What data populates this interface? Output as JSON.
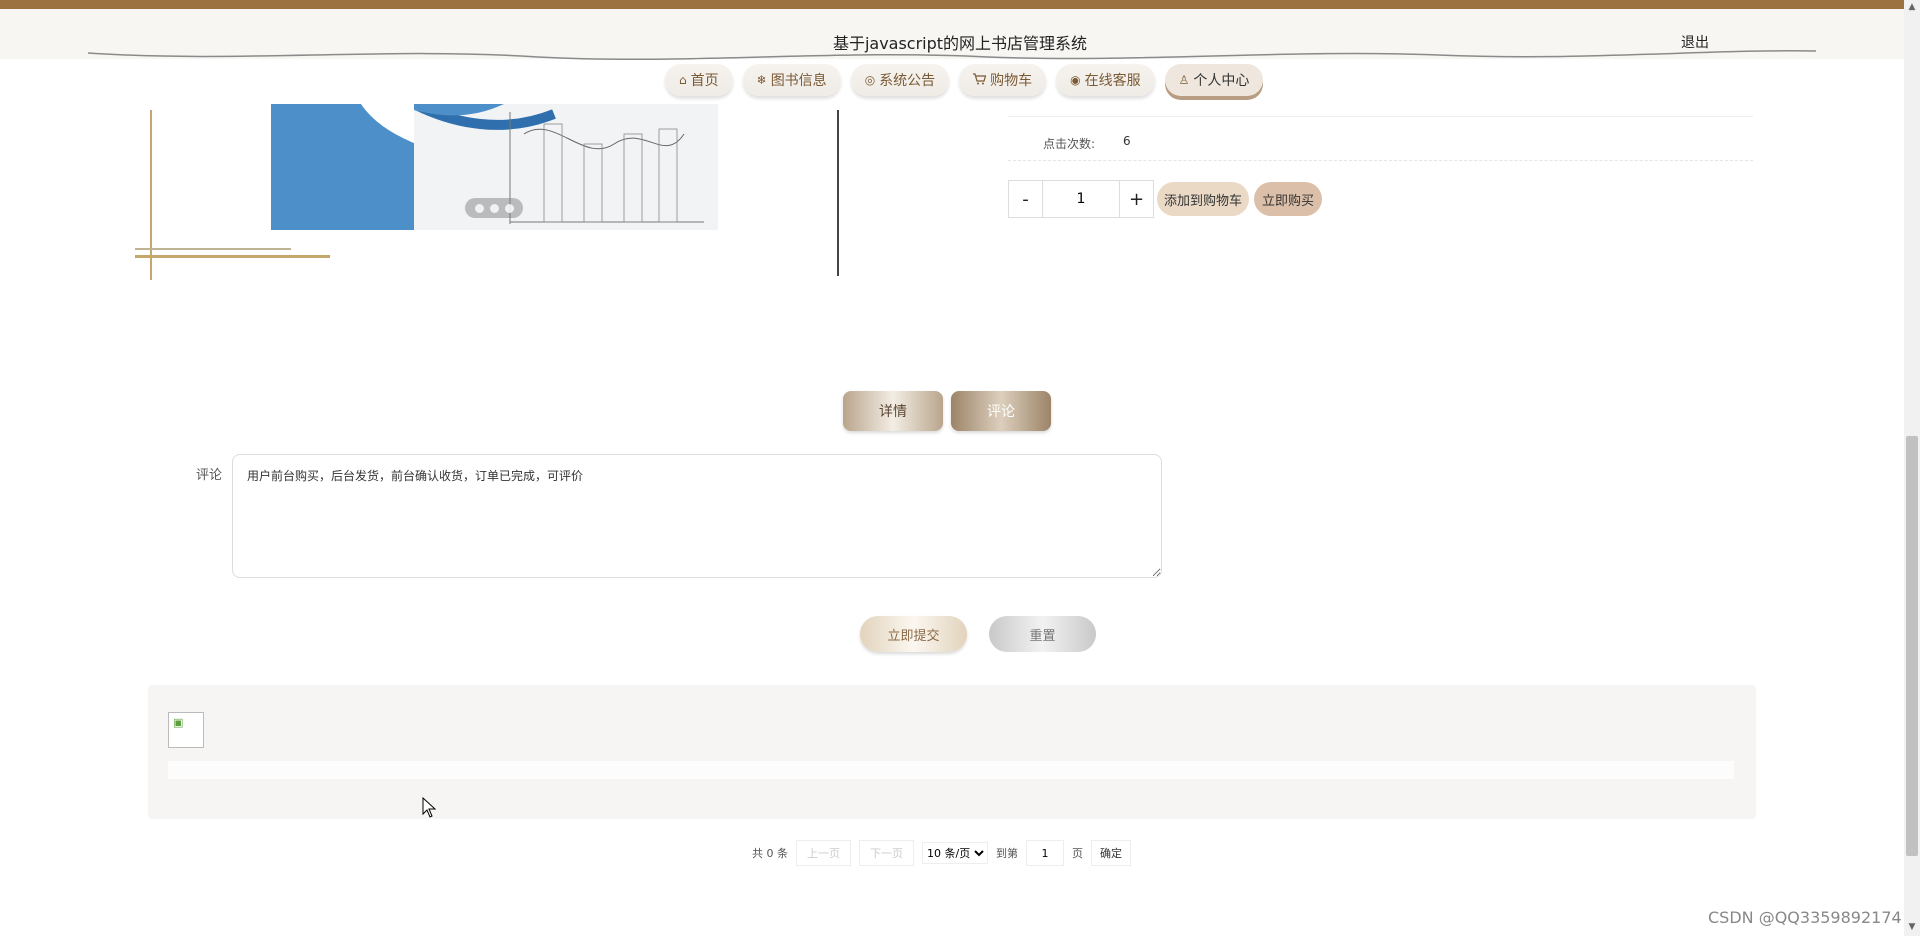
{
  "header": {
    "title": "基于javascript的网上书店管理系统",
    "logout": "退出"
  },
  "nav": [
    {
      "label": "首页",
      "icon": "home-icon",
      "glyph": "⌂"
    },
    {
      "label": "图书信息",
      "icon": "snowflake-icon",
      "glyph": "❄"
    },
    {
      "label": "系统公告",
      "icon": "globe-icon",
      "glyph": "◎"
    },
    {
      "label": "购物车",
      "icon": "cart-icon",
      "glyph": "🛒"
    },
    {
      "label": "在线客服",
      "icon": "chat-icon",
      "glyph": "◉"
    },
    {
      "label": "个人中心",
      "icon": "user-icon",
      "glyph": "♙"
    }
  ],
  "product": {
    "click_label": "点击次数:",
    "click_count": "6",
    "quantity": "1",
    "minus": "-",
    "plus": "+",
    "add_to_cart": "添加到购物车",
    "buy_now": "立即购买"
  },
  "tabs": {
    "detail": "详情",
    "comment": "评论"
  },
  "comment_form": {
    "label": "评论",
    "value": "用户前台购买，后台发货，前台确认收货，订单已完成，可评价",
    "submit": "立即提交",
    "reset": "重置"
  },
  "pagination": {
    "total": "共 0 条",
    "prev": "上一页",
    "next": "下一页",
    "page_size": "10 条/页",
    "goto": "到第",
    "page": "1",
    "page_unit": "页",
    "confirm": "确定"
  },
  "watermark": "CSDN @QQ3359892174",
  "colors": {
    "topbar": "#9b7240",
    "accent": "#7a5a35",
    "slide_blue": "#4d8fc8"
  }
}
